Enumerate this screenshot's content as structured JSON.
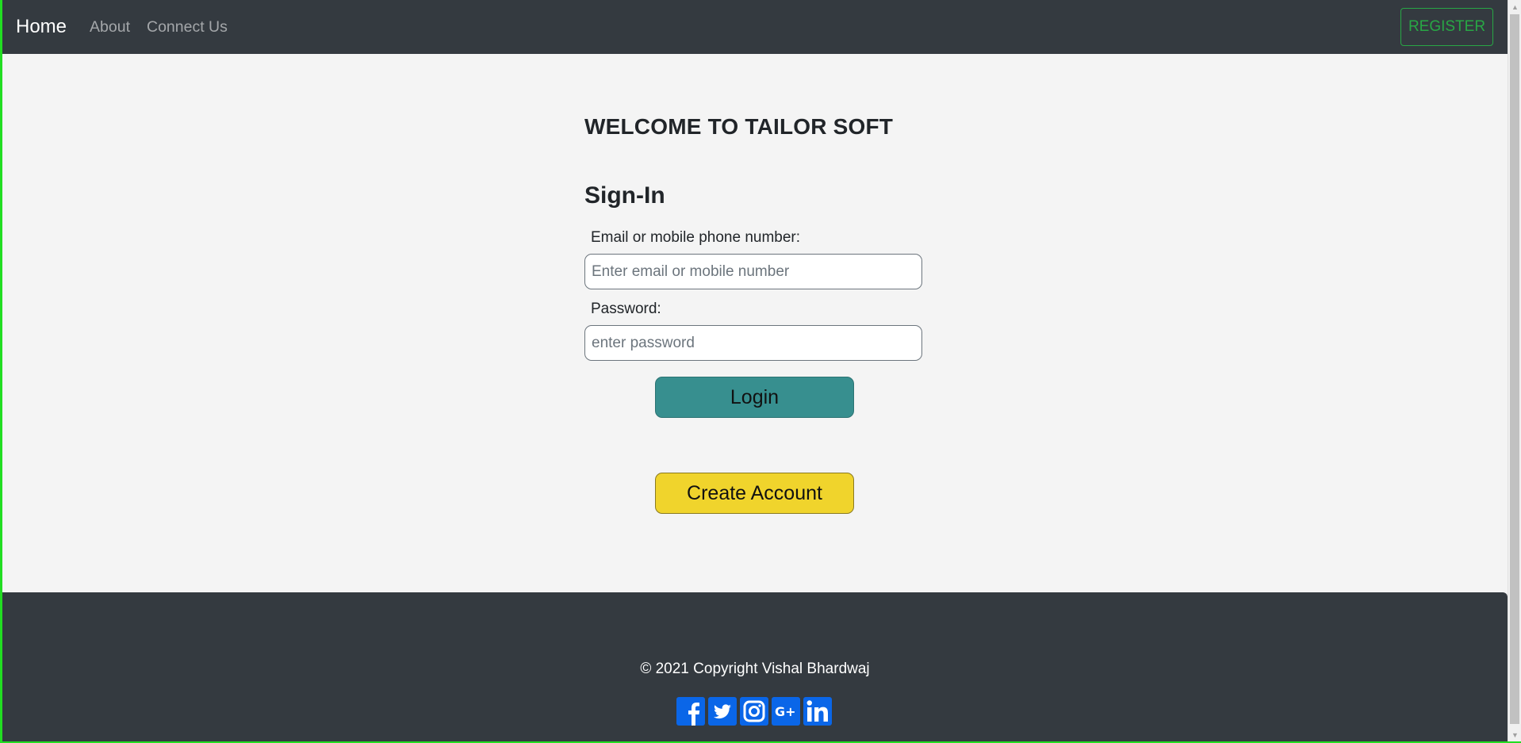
{
  "navbar": {
    "brand": "Home",
    "links": [
      "About",
      "Connect Us"
    ],
    "register_label": "REGISTER"
  },
  "main": {
    "welcome": "WELCOME TO TAILOR SOFT",
    "signin_title": "Sign-In",
    "email_label": "Email or mobile phone number:",
    "email_placeholder": "Enter email or mobile number",
    "password_label": "Password:",
    "password_placeholder": "enter password",
    "login_label": "Login",
    "create_account_label": "Create Account"
  },
  "footer": {
    "copyright": "© 2021 Copyright Vishal Bhardwaj",
    "social_icons": [
      "facebook-icon",
      "twitter-icon",
      "instagram-icon",
      "google-plus-icon",
      "linkedin-icon"
    ]
  },
  "colors": {
    "navbar_bg": "#343a40",
    "register_accent": "#28a745",
    "login_bg": "#378f8f",
    "create_bg": "#f0d42c",
    "social_blue": "#0a66e8"
  }
}
